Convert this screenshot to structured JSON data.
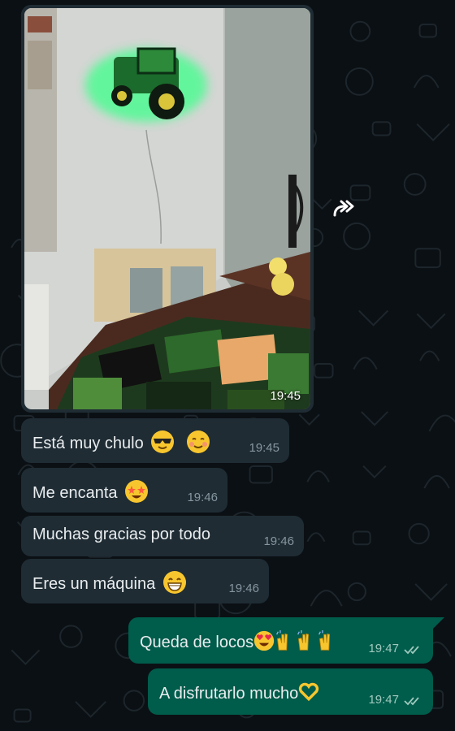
{
  "chat": {
    "photo_message": {
      "time": "19:45"
    },
    "messages": [
      {
        "text": "Está muy chulo",
        "emojis": [
          "smiling-face-with-sunglasses",
          "smiling-face"
        ],
        "time": "19:45",
        "direction": "incoming"
      },
      {
        "text": "Me encanta",
        "emojis": [
          "star-struck"
        ],
        "time": "19:46",
        "direction": "incoming"
      },
      {
        "text": "Muchas gracias por todo",
        "emojis": [],
        "time": "19:46",
        "direction": "incoming"
      },
      {
        "text": "Eres un máquina",
        "emojis": [
          "grinning-face"
        ],
        "time": "19:46",
        "direction": "incoming"
      },
      {
        "text": "Queda de locos",
        "emojis": [
          "heart-eyes",
          "raising-hands",
          "raising-hands",
          "raising-hands"
        ],
        "time": "19:47",
        "direction": "outgoing",
        "status": "read"
      },
      {
        "text": "A disfrutarlo mucho",
        "emojis": [
          "heart-hands"
        ],
        "time": "19:47",
        "direction": "outgoing",
        "status": "read"
      }
    ]
  },
  "icons": {
    "forward": "forward-icon",
    "read_receipt": "double-check-icon"
  },
  "colors": {
    "background": "#0b1014",
    "incoming_bubble": "#1f2c34",
    "outgoing_bubble": "#005c4b",
    "text": "#e9edef",
    "timestamp": "#8696a0"
  }
}
